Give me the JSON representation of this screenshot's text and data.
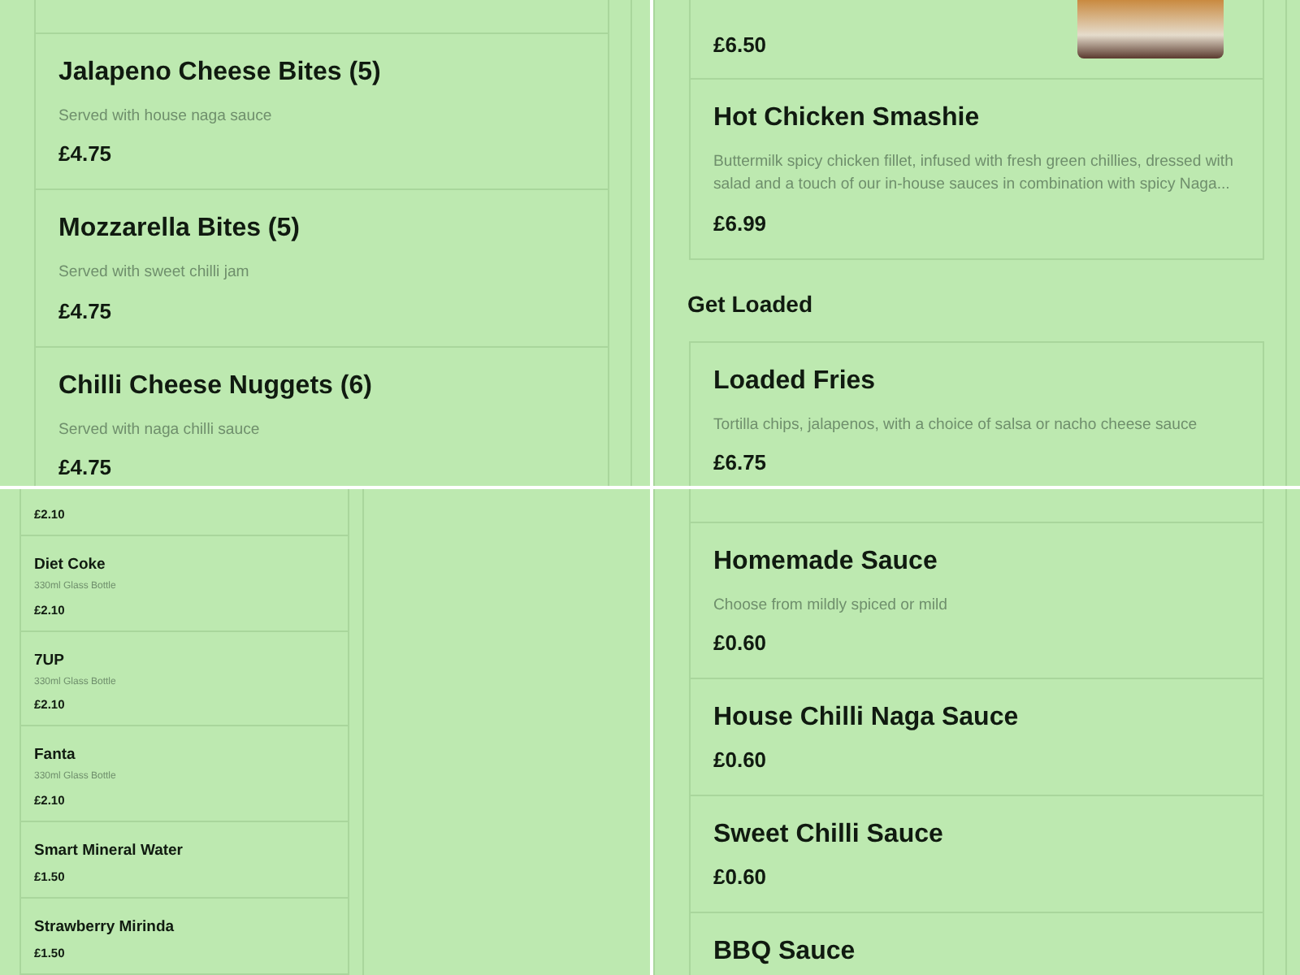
{
  "quadrants": [
    {
      "kind": "wide",
      "blocks": [
        {
          "kind": "card",
          "items": [
            {
              "kind": "cut"
            },
            {
              "kind": "item",
              "name": "Jalapeno Cheese Bites (5)",
              "description": "Served with house naga sauce",
              "price": "£4.75"
            },
            {
              "kind": "item",
              "name": "Mozzarella Bites (5)",
              "description": "Served with sweet chilli jam",
              "price": "£4.75"
            },
            {
              "kind": "item",
              "name": "Chilli Cheese Nuggets (6)",
              "description": "Served with naga chilli sauce",
              "price": "£4.75"
            }
          ]
        }
      ]
    },
    {
      "kind": "wide",
      "blocks": [
        {
          "kind": "card",
          "items": [
            {
              "kind": "cut",
              "price": "£6.50",
              "photo": true
            },
            {
              "kind": "item",
              "name": "Hot Chicken Smashie",
              "description": "Buttermilk spicy chicken fillet, infused with fresh green chillies, dressed with salad and a touch of our in-house sauces in combination with spicy Naga...",
              "price": "£6.99"
            }
          ]
        },
        {
          "kind": "heading",
          "text": "Get Loaded"
        },
        {
          "kind": "card",
          "items": [
            {
              "kind": "item",
              "name": "Loaded Fries",
              "description": "Tortilla chips, jalapenos, with a choice of salsa or nacho cheese sauce",
              "price": "£6.75"
            }
          ]
        }
      ]
    },
    {
      "kind": "small",
      "blocks": [
        {
          "kind": "card",
          "items": [
            {
              "kind": "cut",
              "price": "£2.10"
            },
            {
              "kind": "item",
              "name": "Diet Coke",
              "description": "330ml Glass Bottle",
              "price": "£2.10"
            },
            {
              "kind": "item",
              "name": "7UP",
              "description": "330ml Glass Bottle",
              "price": "£2.10"
            },
            {
              "kind": "item",
              "name": "Fanta",
              "description": "330ml Glass Bottle",
              "price": "£2.10"
            },
            {
              "kind": "item",
              "name": "Smart Mineral Water",
              "price": "£1.50"
            },
            {
              "kind": "item",
              "name": "Strawberry Mirinda",
              "price": "£1.50"
            }
          ]
        }
      ]
    },
    {
      "kind": "wide",
      "blocks": [
        {
          "kind": "card",
          "items": [
            {
              "kind": "cut"
            },
            {
              "kind": "item",
              "name": "Homemade Sauce",
              "description": "Choose from mildly spiced or mild",
              "price": "£0.60"
            },
            {
              "kind": "item",
              "name": "House Chilli Naga Sauce",
              "price": "£0.60"
            },
            {
              "kind": "item",
              "name": "Sweet Chilli Sauce",
              "price": "£0.60"
            },
            {
              "kind": "item",
              "name": "BBQ Sauce"
            }
          ]
        }
      ]
    }
  ]
}
